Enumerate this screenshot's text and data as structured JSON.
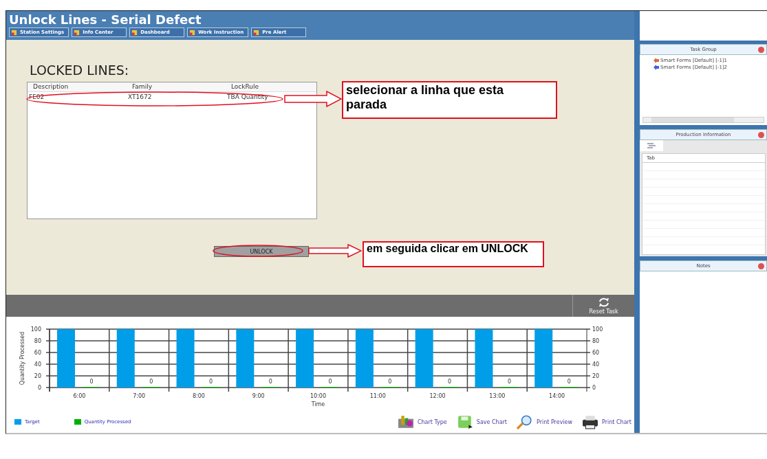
{
  "window": {
    "title": "Unlock Lines - Serial Defect"
  },
  "nav_buttons": [
    "Station Settings",
    "Info Center",
    "Dashboard",
    "Work Instruction",
    "Pre Alert"
  ],
  "locked_lines": {
    "title": "LOCKED LINES:",
    "columns": [
      "Description",
      "Family",
      "LockRule"
    ],
    "rows": [
      [
        "FE02",
        "XT1672",
        "TBA Quantity"
      ]
    ]
  },
  "unlock_button": "UNLOCK",
  "annotations": [
    {
      "text": "selecionar a linha que esta parada"
    },
    {
      "text": "em seguida clicar em UNLOCK"
    }
  ],
  "reset_button": "Reset Task",
  "chart": {
    "chart_data": {
      "type": "bar",
      "xlabel": "Time",
      "ylabel": "Quantity Processed",
      "categories": [
        "6:00",
        "7:00",
        "8:00",
        "9:00",
        "10:00",
        "11:00",
        "12:00",
        "13:00",
        "14:00"
      ],
      "series": [
        {
          "name": "Target",
          "color": "#009ee8",
          "values": [
            100,
            100,
            100,
            100,
            100,
            100,
            100,
            100,
            100
          ],
          "value_labels": [
            null,
            null,
            null,
            null,
            null,
            null,
            null,
            null,
            null
          ]
        },
        {
          "name": "Quantity Processed",
          "color": "#00b000",
          "values": [
            0,
            0,
            0,
            0,
            0,
            0,
            0,
            0,
            0
          ],
          "value_labels": [
            "0",
            "0",
            "0",
            "0",
            "0",
            "0",
            "0",
            "0",
            "0"
          ]
        }
      ],
      "ylim": [
        0,
        100
      ],
      "yticks": [
        0,
        20,
        40,
        60,
        80,
        100
      ],
      "y2ticks": [
        0,
        20,
        40,
        60,
        80,
        100
      ],
      "y2lim": [
        0,
        100
      ],
      "grid": true,
      "legend": "bottom"
    },
    "tools": [
      {
        "label": "Chart Type",
        "kind": "type"
      },
      {
        "label": "Save Chart",
        "kind": "save"
      },
      {
        "label": "Print Preview",
        "kind": "preview"
      },
      {
        "label": "Print Chart",
        "kind": "print"
      }
    ]
  },
  "sidebar": {
    "task_group": {
      "title": "Task Group",
      "items": [
        "Smart Forms [Default] [-1]1",
        "Smart Forms [Default] [-1]2"
      ]
    },
    "production_information": {
      "title": "Production Information",
      "column": "Tab"
    },
    "notes": {
      "title": "Notes"
    }
  }
}
